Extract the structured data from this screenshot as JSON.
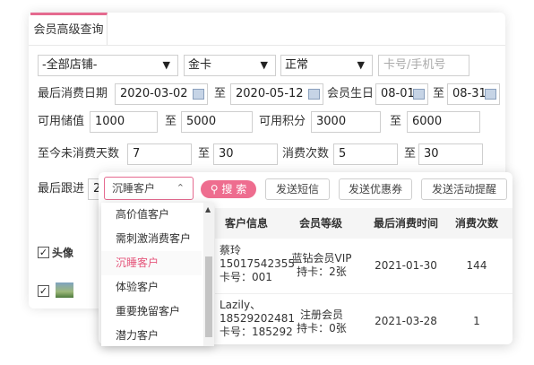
{
  "tab": {
    "title": "会员高级查询"
  },
  "filters": {
    "store": "-全部店铺-",
    "card_type": "金卡",
    "status": "正常",
    "card_phone_placeholder": "卡号/手机号",
    "last_consume_label": "最后消费日期",
    "last_consume_from": "2020-03-02",
    "last_consume_to": "2020-05-12",
    "to": "至",
    "birthday_label": "会员生日",
    "birthday_from": "08-01",
    "birthday_to": "08-31",
    "stored_value_label": "可用储值",
    "stored_value_from": "1000",
    "stored_value_to": "5000",
    "points_label": "可用积分",
    "points_from": "3000",
    "points_to": "6000",
    "days_no_consume_label": "至今未消费天数",
    "days_from": "7",
    "days_to": "30",
    "consume_count_label": "消费次数",
    "count_from": "5",
    "count_to": "30",
    "follow_label": "最后跟进",
    "follow_value": "2"
  },
  "toolbar": {
    "customer_type": "沉睡客户",
    "search": "搜 索",
    "send_sms": "发送短信",
    "send_coupon": "发送优惠券",
    "send_event": "发送活动提醒"
  },
  "dropdown": {
    "options": [
      "高价值客户",
      "需刺激消费客户",
      "沉睡客户",
      "体验客户",
      "重要挽留客户",
      "潜力客户"
    ],
    "selected_index": 2
  },
  "table": {
    "avatar_header": "头像",
    "headers": [
      "客户信息",
      "会员等级",
      "最后消费时间",
      "消费次数"
    ],
    "rows": [
      {
        "name": "蔡玲",
        "phone": "15017542355",
        "card": "卡号：001",
        "level": "蓝钻会员VIP",
        "cards_held": "持卡：2张",
        "last_time": "2021-01-30",
        "count": "144"
      },
      {
        "name": "Lazily、",
        "phone": "18529202481",
        "card": "卡号：185292",
        "level": "注册会员",
        "cards_held": "持卡：0张",
        "last_time": "2021-03-28",
        "count": "1"
      }
    ]
  },
  "colors": {
    "accent": "#e56a8f",
    "search_button": "#ee6d8f"
  }
}
